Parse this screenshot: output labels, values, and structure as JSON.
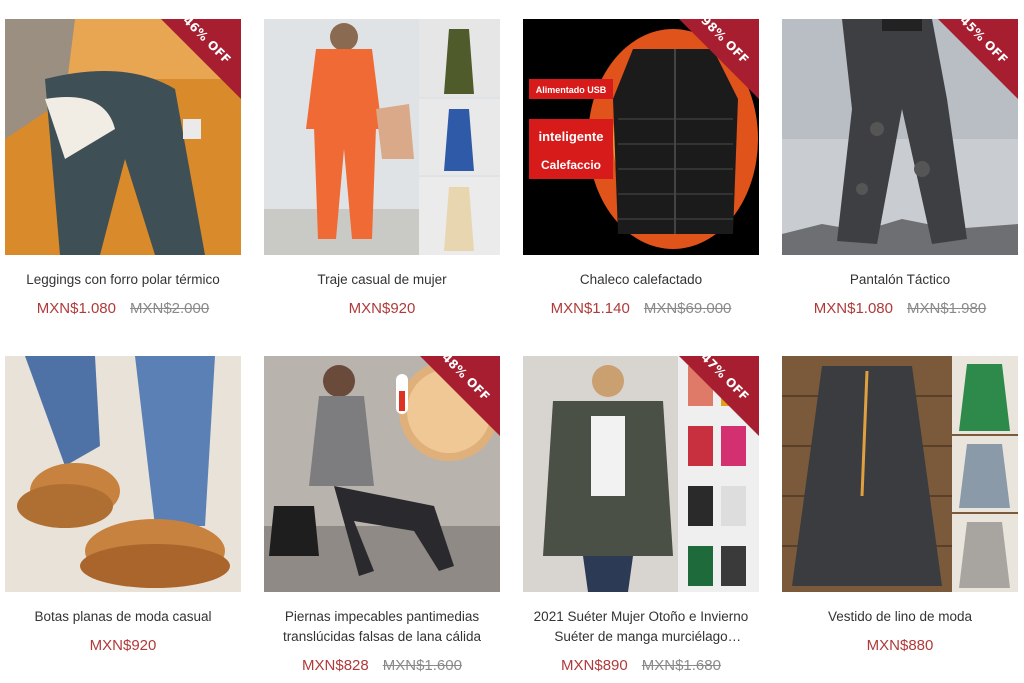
{
  "products": [
    {
      "title": "Leggings con forro polar térmico",
      "price": "MXN$1.080",
      "old_price": "MXN$2.000",
      "badge": "46% OFF"
    },
    {
      "title": "Traje casual de mujer",
      "price": "MXN$920",
      "old_price": "",
      "badge": ""
    },
    {
      "title": "Chaleco calefactado",
      "price": "MXN$1.140",
      "old_price": "MXN$69.000",
      "badge": "98% OFF",
      "image_text": {
        "usb": "Alimentado USB",
        "smart": "inteligente",
        "heat": "Calefaccio"
      }
    },
    {
      "title": "Pantalón Táctico",
      "price": "MXN$1.080",
      "old_price": "MXN$1.980",
      "badge": "45% OFF"
    },
    {
      "title": "Botas planas de moda casual",
      "price": "MXN$920",
      "old_price": "",
      "badge": ""
    },
    {
      "title": "Piernas impecables pantimedias translúcidas falsas de lana cálida",
      "price": "MXN$828",
      "old_price": "MXN$1.600",
      "badge": "48% OFF"
    },
    {
      "title": "2021 Suéter Mujer Otoño e Invierno Suéter de manga murciélago Suéter…",
      "price": "MXN$890",
      "old_price": "MXN$1.680",
      "badge": "47% OFF"
    },
    {
      "title": "Vestido de lino de moda",
      "price": "MXN$880",
      "old_price": "",
      "badge": ""
    }
  ],
  "colors": {
    "price": "#b03a3a",
    "badge": "#a61e30",
    "old_price": "#8a8a8a"
  }
}
